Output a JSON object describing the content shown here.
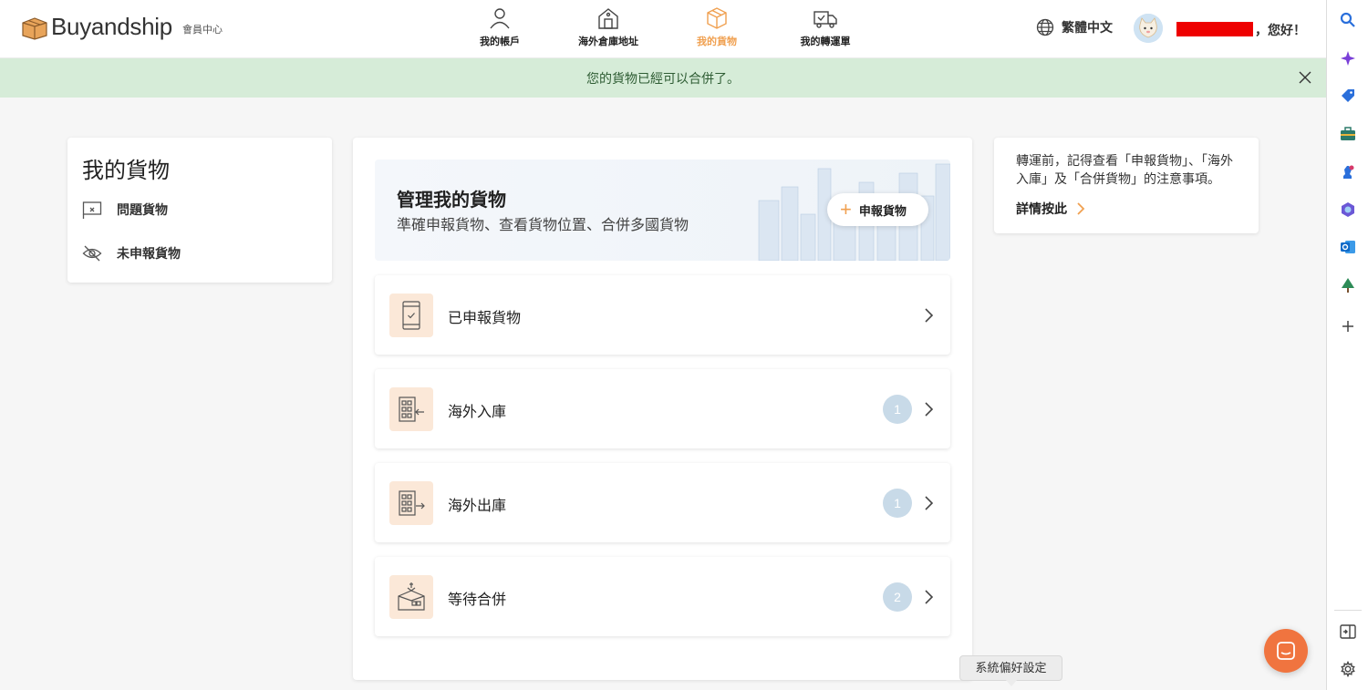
{
  "header": {
    "logo_text": "Buyandship",
    "logo_sub": "會員中心",
    "nav": [
      {
        "label": "我的帳戶",
        "icon": "user-icon"
      },
      {
        "label": "海外倉庫地址",
        "icon": "warehouse-icon"
      },
      {
        "label": "我的貨物",
        "icon": "package-icon",
        "active": true
      },
      {
        "label": "我的轉運單",
        "icon": "truck-icon"
      }
    ],
    "language": "繁體中文",
    "greeting": "，您好！"
  },
  "banner": {
    "message": "您的貨物已經可以合併了。"
  },
  "left_menu": {
    "title": "我的貨物",
    "items": [
      {
        "label": "問題貨物",
        "icon": "flag-icon"
      },
      {
        "label": "未申報貨物",
        "icon": "eye-off-icon"
      }
    ]
  },
  "main": {
    "hero_title": "管理我的貨物",
    "hero_subtitle": "準確申報貨物、查看貨物位置、合併多國貨物",
    "declare_button": "申報貨物",
    "rows": [
      {
        "label": "已申報貨物",
        "icon": "phone-check-icon",
        "count": ""
      },
      {
        "label": "海外入庫",
        "icon": "warehouse-in-icon",
        "count": "1"
      },
      {
        "label": "海外出庫",
        "icon": "warehouse-out-icon",
        "count": "1"
      },
      {
        "label": "等待合併",
        "icon": "merge-box-icon",
        "count": "2"
      }
    ]
  },
  "info_card": {
    "text": "轉運前，記得查看「申報貨物」、「海外入庫」及「合併貨物」的注意事項。",
    "link": "詳情按此"
  },
  "tooltip": "系統偏好設定",
  "colors": {
    "accent": "#f0a050",
    "banner_bg": "#d6ecd8",
    "icon_bg": "#fbe8d8",
    "badge_bg": "#c8dae8",
    "fab": "#f0743f"
  }
}
